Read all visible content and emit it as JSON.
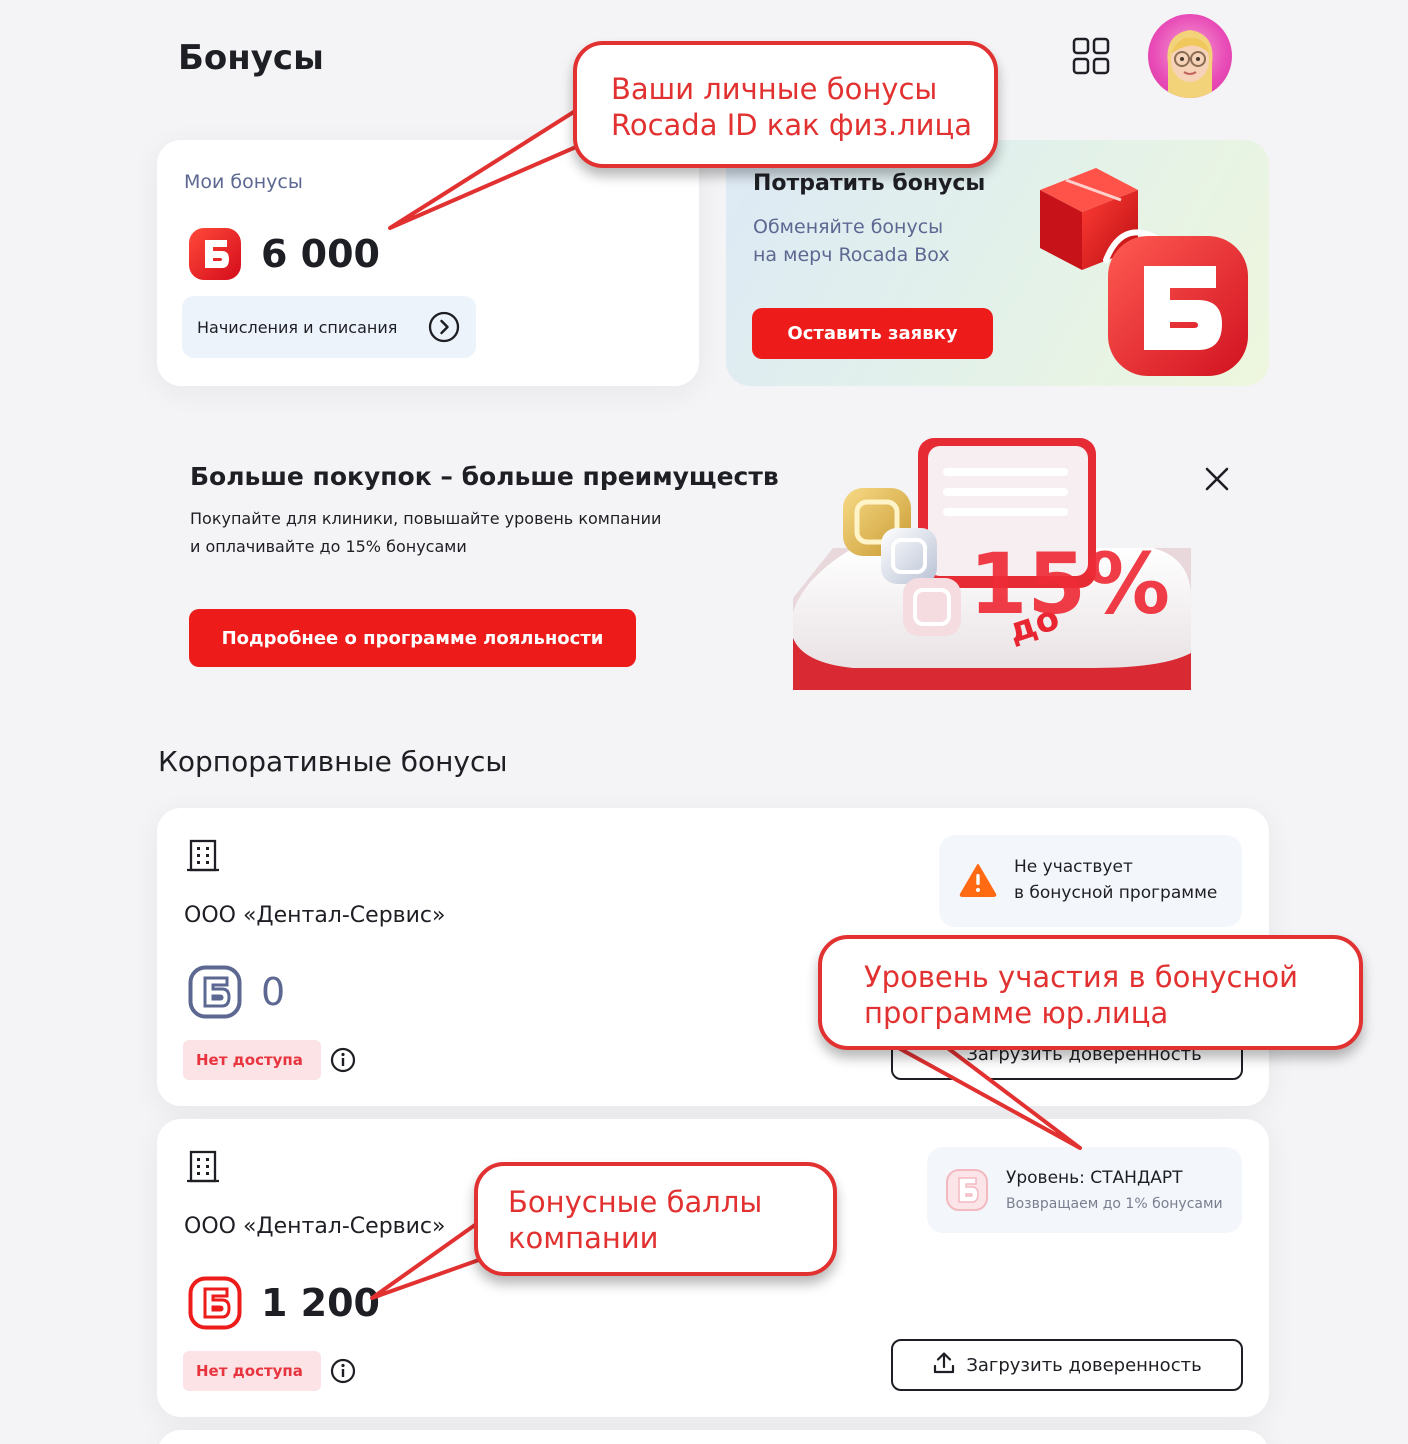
{
  "header": {
    "title": "Бонусы",
    "menu_icon": "grid-icon",
    "avatar_icon": "avatar-memoji"
  },
  "my_bonuses": {
    "label": "Мои бонусы",
    "amount": "6 000",
    "history_label": "Начисления и списания"
  },
  "spend": {
    "title": "Потратить бонусы",
    "subtitle_line1": "Обменяйте бонусы",
    "subtitle_line2": "на мерч Rocada Box",
    "button": "Оставить заявку"
  },
  "promo": {
    "title": "Больше покупок – больше преимуществ",
    "text_line1": "Покупайте для клиники, повышайте уровень компании",
    "text_line2": "и оплачивайте до 15% бонусами",
    "button": "Подробнее о программе лояльности",
    "badge_prefix": "до",
    "badge_value": "15%"
  },
  "corporate": {
    "title": "Корпоративные бонусы",
    "companies": [
      {
        "name": "ООО «Дентал-Сервис»",
        "bonus": "0",
        "access": "Нет доступа",
        "status_line1": "Не участвует",
        "status_line2": "в бонусной программе",
        "upload": "Загрузить доверенность"
      },
      {
        "name": "ООО «Дентал-Сервис»",
        "bonus": "1 200",
        "access": "Нет доступа",
        "status_line1": "Уровень: СТАНДАРТ",
        "status_line2": "Возвращаем до 1% бонусами",
        "upload": "Загрузить доверенность"
      }
    ]
  },
  "callouts": {
    "personal_line1": "Ваши личные бонусы",
    "personal_line2": "Rocada ID как физ.лица",
    "level_line1": "Уровень участия в бонусной",
    "level_line2": "программе юр.лица",
    "company_line1": "Бонусные баллы",
    "company_line2": "компании"
  },
  "colors": {
    "accent": "#ee1b1b",
    "text": "#1e1f24",
    "muted": "#5c6891",
    "warning": "#ff6a13"
  }
}
